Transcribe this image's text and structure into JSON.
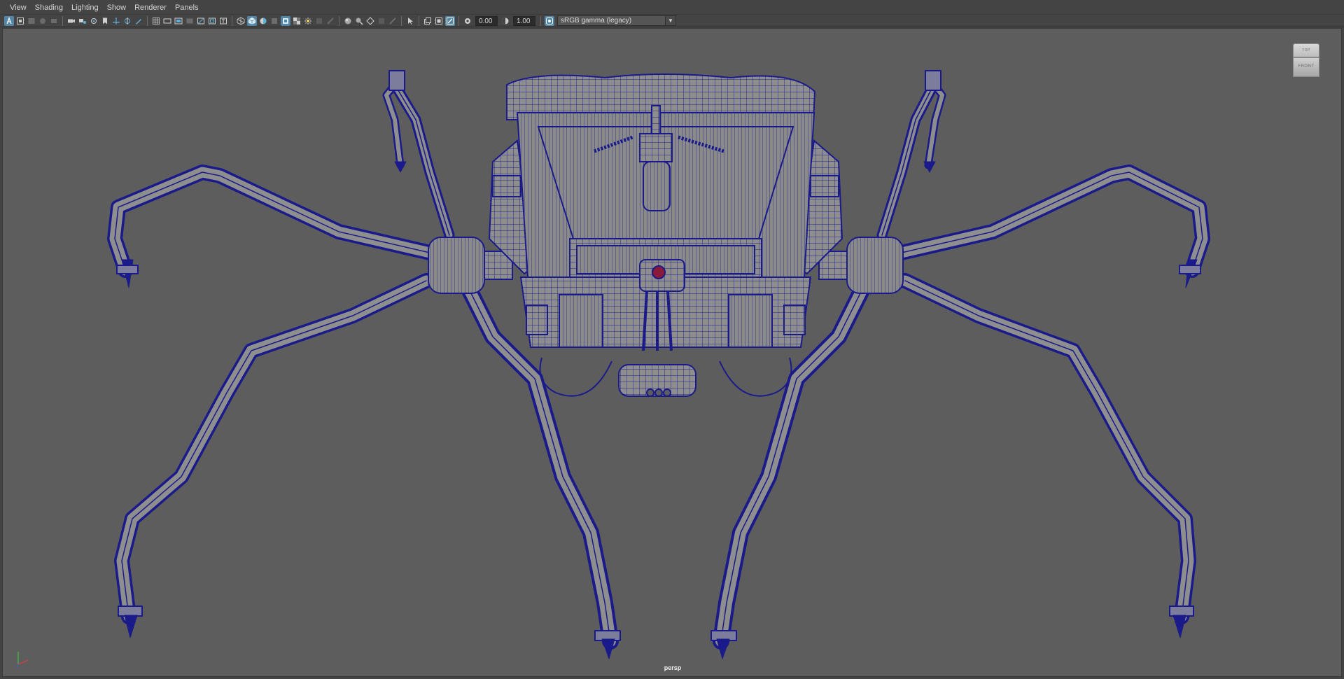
{
  "menubar": {
    "items": [
      "View",
      "Shading",
      "Lighting",
      "Show",
      "Renderer",
      "Panels"
    ]
  },
  "toolbar": {
    "exposure_value": "0.00",
    "gamma_value": "1.00",
    "color_space": "sRGB gamma (legacy)"
  },
  "viewport": {
    "camera_label": "persp",
    "viewcube": {
      "top_label": "TOP",
      "front_label": "FRONT"
    }
  },
  "colors": {
    "wireframe": "#1a1a8a",
    "mesh_fill": "#8d8d8d",
    "viewport_bg": "#5d5d5d",
    "active_button": "#5285a6"
  },
  "icons": {
    "toolbar": [
      "select-camera-icon",
      "camera-attributes-icon",
      "bookmark-icon",
      "image-plane-icon",
      "2d-pan-zoom-icon",
      "grease-pencil-icon",
      "grid-icon",
      "film-gate-icon",
      "resolution-gate-icon",
      "gate-mask-icon",
      "field-chart-icon",
      "safe-action-icon",
      "safe-title-icon",
      "wireframe-icon",
      "smooth-shade-icon",
      "default-material-icon",
      "textured-icon",
      "use-lights-icon",
      "shadows-icon",
      "screen-ambient-occlusion-icon",
      "motion-blur-icon",
      "anti-aliasing-icon",
      "depth-of-field-icon",
      "isolate-select-icon",
      "xray-icon",
      "xray-active-icon",
      "xray-joints-icon",
      "exposure-icon",
      "gamma-icon",
      "color-management-icon"
    ]
  }
}
